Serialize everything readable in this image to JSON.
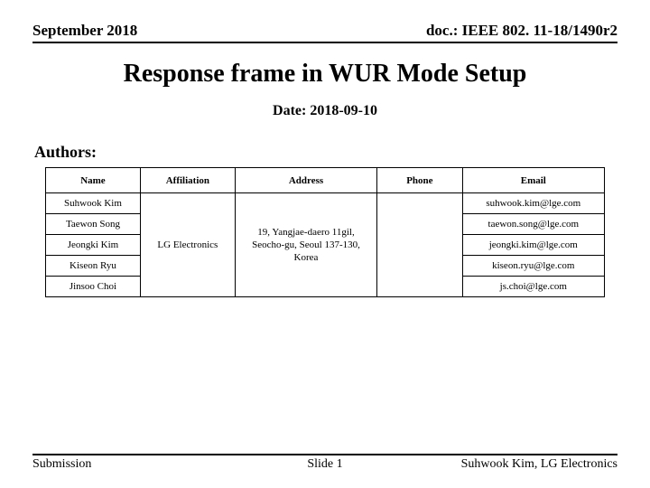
{
  "header": {
    "date": "September 2018",
    "doc": "doc.: IEEE 802. 11-18/1490r2"
  },
  "title": "Response frame in WUR Mode Setup",
  "date_line": "Date: 2018-09-10",
  "authors_label": "Authors:",
  "table": {
    "headers": {
      "name": "Name",
      "affiliation": "Affiliation",
      "address": "Address",
      "phone": "Phone",
      "email": "Email"
    },
    "affiliation": "LG Electronics",
    "address": "19, Yangjae-daero 11gil, Seocho-gu, Seoul 137-130, Korea",
    "rows": [
      {
        "name": "Suhwook Kim",
        "email": "suhwook.kim@lge.com"
      },
      {
        "name": "Taewon Song",
        "email": "taewon.song@lge.com"
      },
      {
        "name": "Jeongki Kim",
        "email": "jeongki.kim@lge.com"
      },
      {
        "name": "Kiseon Ryu",
        "email": "kiseon.ryu@lge.com"
      },
      {
        "name": "Jinsoo Choi",
        "email": "js.choi@lge.com"
      }
    ]
  },
  "footer": {
    "left": "Submission",
    "center": "Slide 1",
    "right": "Suhwook Kim, LG Electronics"
  }
}
